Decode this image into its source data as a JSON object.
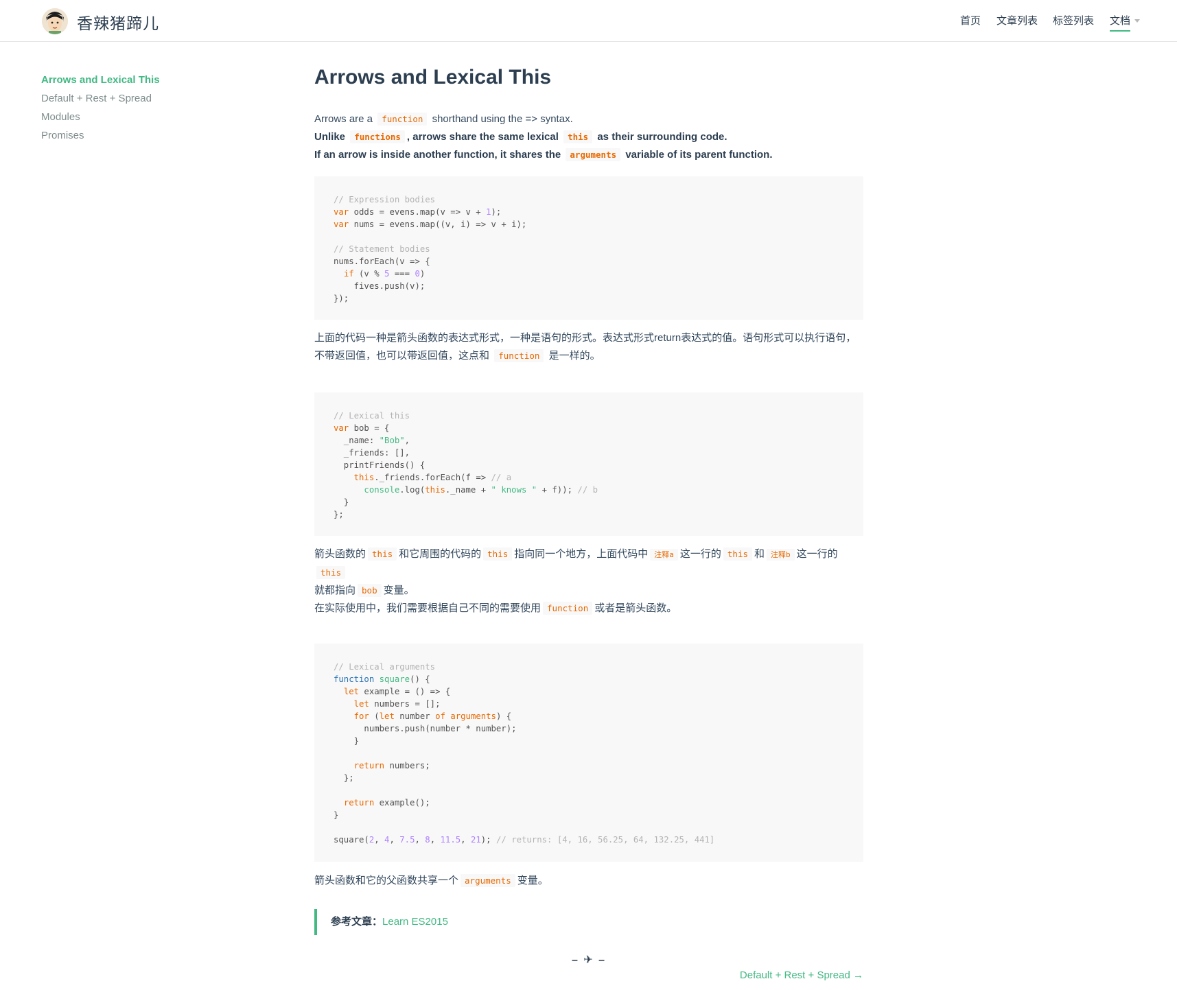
{
  "header": {
    "site_title": "香辣猪蹄儿",
    "nav": [
      "首页",
      "文章列表",
      "标签列表",
      "文档"
    ]
  },
  "sidebar": {
    "items": [
      "Arrows and Lexical This",
      "Default + Rest + Spread",
      "Modules",
      "Promises"
    ]
  },
  "article": {
    "title": "Arrows and Lexical This",
    "intro": {
      "p1_a": "Arrows are a",
      "p1_code": "function",
      "p1_b": "shorthand using the => syntax.",
      "p2_a": "Unlike",
      "p2_code1": "functions",
      "p2_b": ", arrows share the same lexical",
      "p2_code2": "this",
      "p2_c": "as their surrounding code.",
      "p3_a": "If an arrow is inside another function, it shares the",
      "p3_code": "arguments",
      "p3_b": "variable of its parent function."
    },
    "after_code1": {
      "line1": "上面的代码一种是箭头函数的表达式形式，一种是语句的形式。表达式形式return表达式的值。语句形式可以执行语句，",
      "line2_a": "不带返回值，也可以带返回值，这点和",
      "line2_code": "function",
      "line2_b": "是一样的。"
    },
    "after_code2": {
      "s1": "箭头函数的",
      "c1": "this",
      "s2": "和它周围的代码的",
      "c2": "this",
      "s3": "指向同一个地方，上面代码中",
      "c3": "注释a",
      "s4": "这一行的",
      "c4": "this",
      "s5": "和",
      "c5": "注释b",
      "s6": "这一行的",
      "c6": "this",
      "s7": "就都指向",
      "c7": "bob",
      "s8": "变量。",
      "s9": "在实际使用中，我们需要根据自己不同的需要使用",
      "c9": "function",
      "s10": "或者是箭头函数。"
    },
    "after_code3": {
      "a": "箭头函数和它的父函数共享一个",
      "code": "arguments",
      "b": "变量。"
    },
    "reference": {
      "label": "参考文章：",
      "link": "Learn ES2015"
    },
    "end_mark": "– ✈ –",
    "next_link": "Default + Rest + Spread →"
  },
  "code_blocks": [
    "// Expression bodies\nvar odds = evens.map(v => v + 1);\nvar nums = evens.map((v, i) => v + i);\n\n// Statement bodies\nnums.forEach(v => {\n  if (v % 5 === 0)\n    fives.push(v);\n});",
    "// Lexical this\nvar bob = {\n  _name: \"Bob\",\n  _friends: [],\n  printFriends() {\n    this._friends.forEach(f => // a\n      console.log(this._name + \" knows \" + f)); // b\n  }\n};",
    "// Lexical arguments\nfunction square() {\n  let example = () => {\n    let numbers = [];\n    for (let number of arguments) {\n      numbers.push(number * number);\n    }\n\n    return numbers;\n  };\n\n  return example();\n}\n\nsquare(2, 4, 7.5, 8, 11.5, 21); // returns: [4, 16, 56.25, 64, 132.25, 441]"
  ]
}
